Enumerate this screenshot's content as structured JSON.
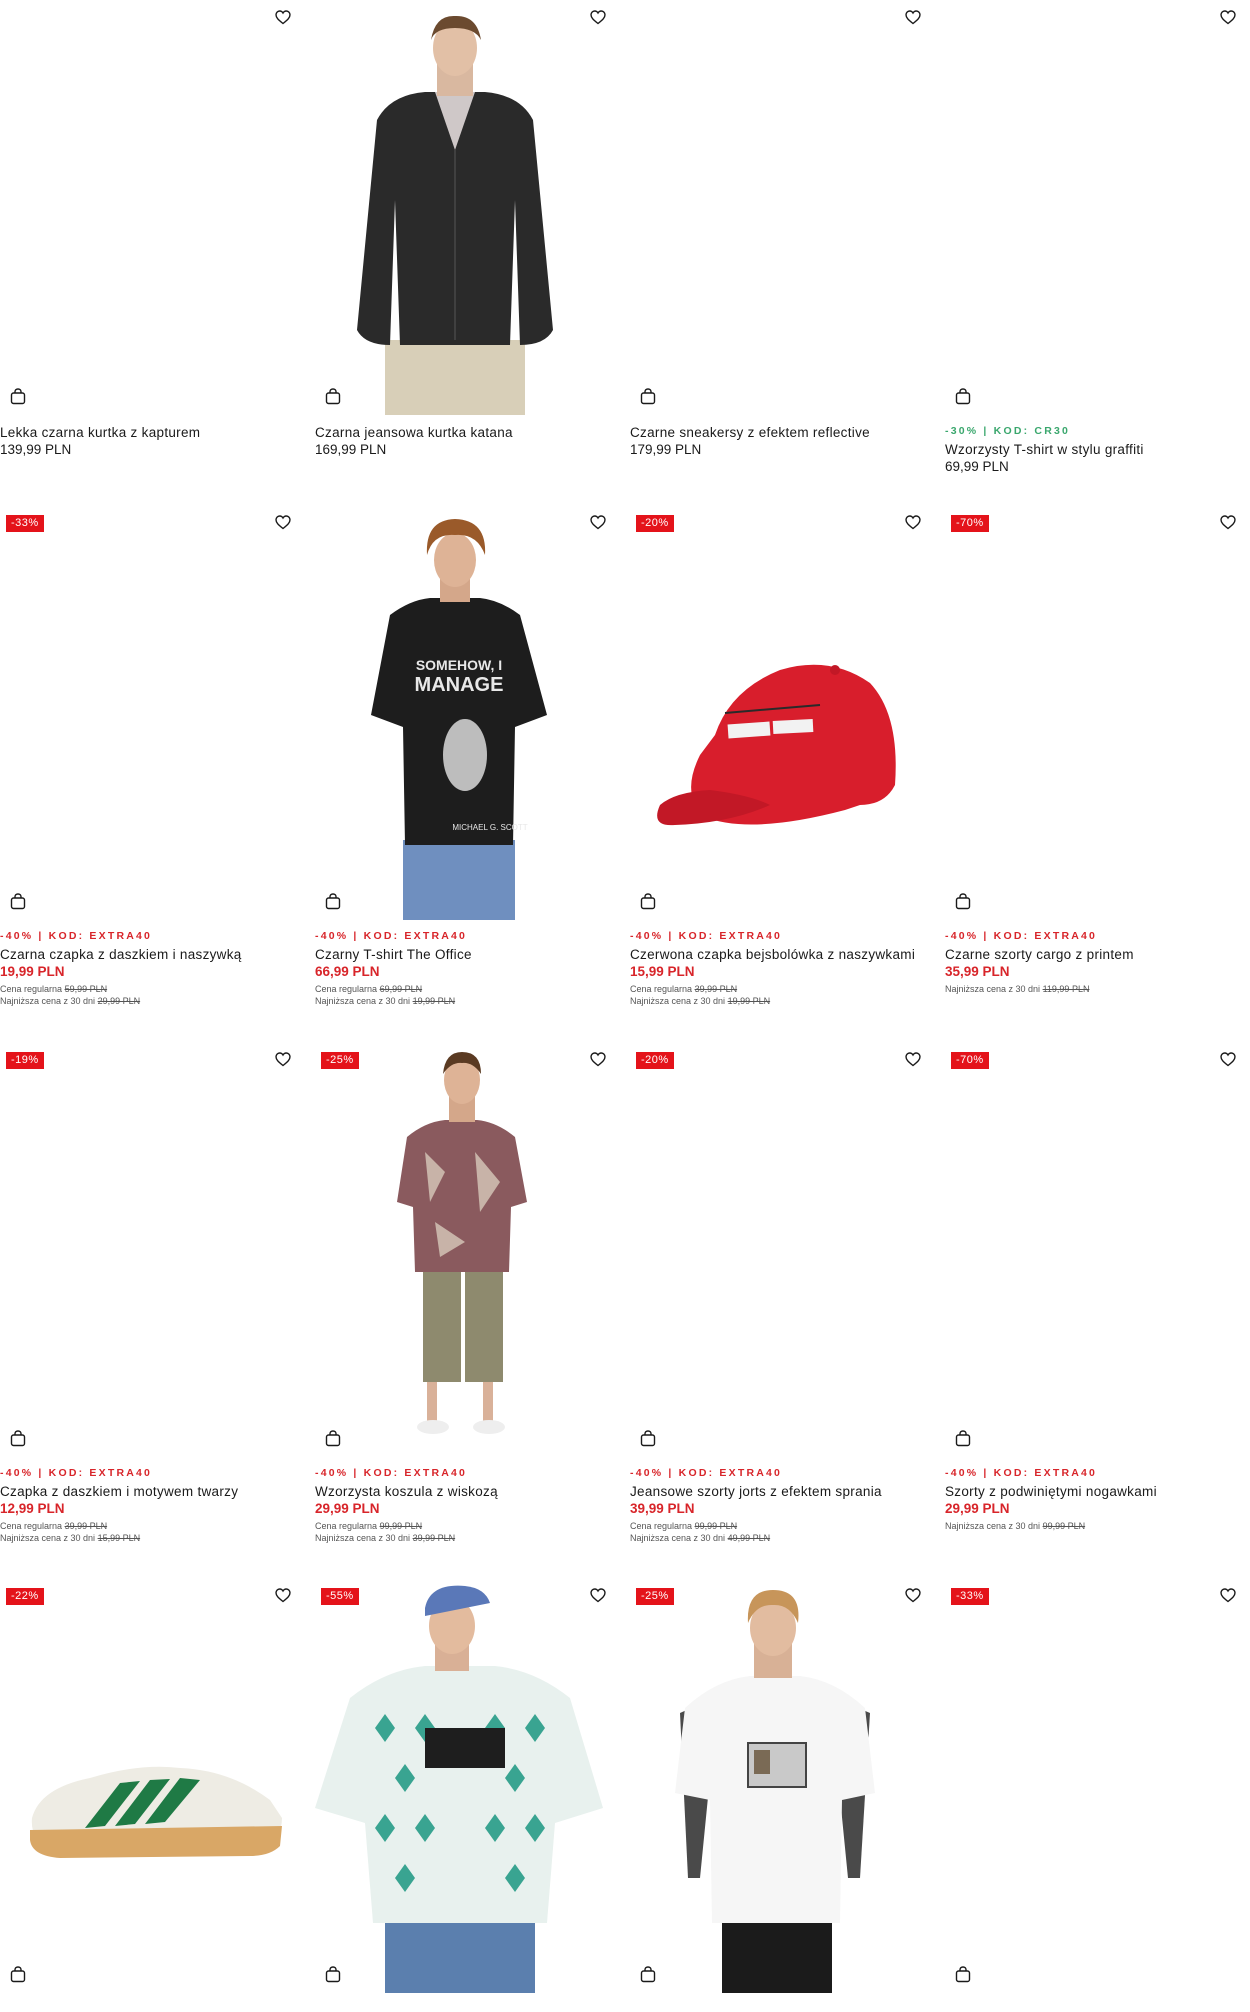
{
  "products": [
    {
      "name": "Lekka czarna kurtka z kapturem",
      "price": "139,99 PLN",
      "badge": "",
      "promo": "",
      "regular": "",
      "lowest": ""
    },
    {
      "name": "Czarna jeansowa kurtka katana",
      "price": "169,99 PLN",
      "badge": "",
      "promo": "",
      "regular": "",
      "lowest": ""
    },
    {
      "name": "Czarne sneakersy z efektem reflective",
      "price": "179,99 PLN",
      "badge": "",
      "promo": "",
      "regular": "",
      "lowest": ""
    },
    {
      "name": "Wzorzysty T-shirt w stylu graffiti",
      "price": "69,99 PLN",
      "badge": "",
      "promo": "-30% | KOD: CR30",
      "regular": "",
      "lowest": ""
    },
    {
      "name": "Czarna czapka z daszkiem i naszywką",
      "price": "19,99 PLN",
      "badge": "-33%",
      "promo": "-40% | KOD: EXTRA40",
      "regular_label": "Cena regularna",
      "regular": "59,99 PLN",
      "lowest_label": "Najniższa cena z 30 dni",
      "lowest": "29,99 PLN"
    },
    {
      "name": "Czarny T-shirt The Office",
      "price": "66,99 PLN",
      "badge": "",
      "promo": "-40% | KOD: EXTRA40",
      "regular_label": "Cena regularna",
      "regular": "69,99 PLN",
      "lowest_label": "Najniższa cena z 30 dni",
      "lowest": "19,99 PLN"
    },
    {
      "name": "Czerwona czapka bejsbolówka z naszywkami",
      "price": "15,99 PLN",
      "badge": "-20%",
      "promo": "-40% | KOD: EXTRA40",
      "regular_label": "Cena regularna",
      "regular": "39,99 PLN",
      "lowest_label": "Najniższa cena z 30 dni",
      "lowest": "19,99 PLN"
    },
    {
      "name": "Czarne szorty cargo z printem",
      "price": "35,99 PLN",
      "badge": "-70%",
      "promo": "-40% | KOD: EXTRA40",
      "regular_label": "",
      "regular": "",
      "lowest_label": "Najniższa cena z 30 dni",
      "lowest": "119,99 PLN"
    },
    {
      "name": "Czapka z daszkiem i motywem twarzy",
      "price": "12,99 PLN",
      "badge": "-19%",
      "promo": "-40% | KOD: EXTRA40",
      "regular_label": "Cena regularna",
      "regular": "39,99 PLN",
      "lowest_label": "Najniższa cena z 30 dni",
      "lowest": "15,99 PLN"
    },
    {
      "name": "Wzorzysta koszula z wiskozą",
      "price": "29,99 PLN",
      "badge": "-25%",
      "promo": "-40% | KOD: EXTRA40",
      "regular_label": "Cena regularna",
      "regular": "99,99 PLN",
      "lowest_label": "Najniższa cena z 30 dni",
      "lowest": "39,99 PLN"
    },
    {
      "name": "Jeansowe szorty jorts z efektem sprania",
      "price": "39,99 PLN",
      "badge": "-20%",
      "promo": "-40% | KOD: EXTRA40",
      "regular_label": "Cena regularna",
      "regular": "99,99 PLN",
      "lowest_label": "Najniższa cena z 30 dni",
      "lowest": "49,99 PLN"
    },
    {
      "name": "Szorty z podwiniętymi nogawkami",
      "price": "29,99 PLN",
      "badge": "-70%",
      "promo": "-40% | KOD: EXTRA40",
      "regular_label": "",
      "regular": "",
      "lowest_label": "Najniższa cena z 30 dni",
      "lowest": "99,99 PLN"
    },
    {
      "name": "",
      "price": "",
      "badge": "-22%",
      "promo": "",
      "regular": "",
      "lowest": ""
    },
    {
      "name": "",
      "price": "",
      "badge": "-55%",
      "promo": "",
      "regular": "",
      "lowest": ""
    },
    {
      "name": "",
      "price": "",
      "badge": "-25%",
      "promo": "",
      "regular": "",
      "lowest": ""
    },
    {
      "name": "",
      "price": "",
      "badge": "-33%",
      "promo": "",
      "regular": "",
      "lowest": ""
    }
  ],
  "icons": {
    "wishlist": "heart-icon",
    "cart": "shopping-bag-icon"
  },
  "colors": {
    "sale": "#d8252a",
    "badge": "#e4131a",
    "promo_green": "#3aa76d"
  }
}
